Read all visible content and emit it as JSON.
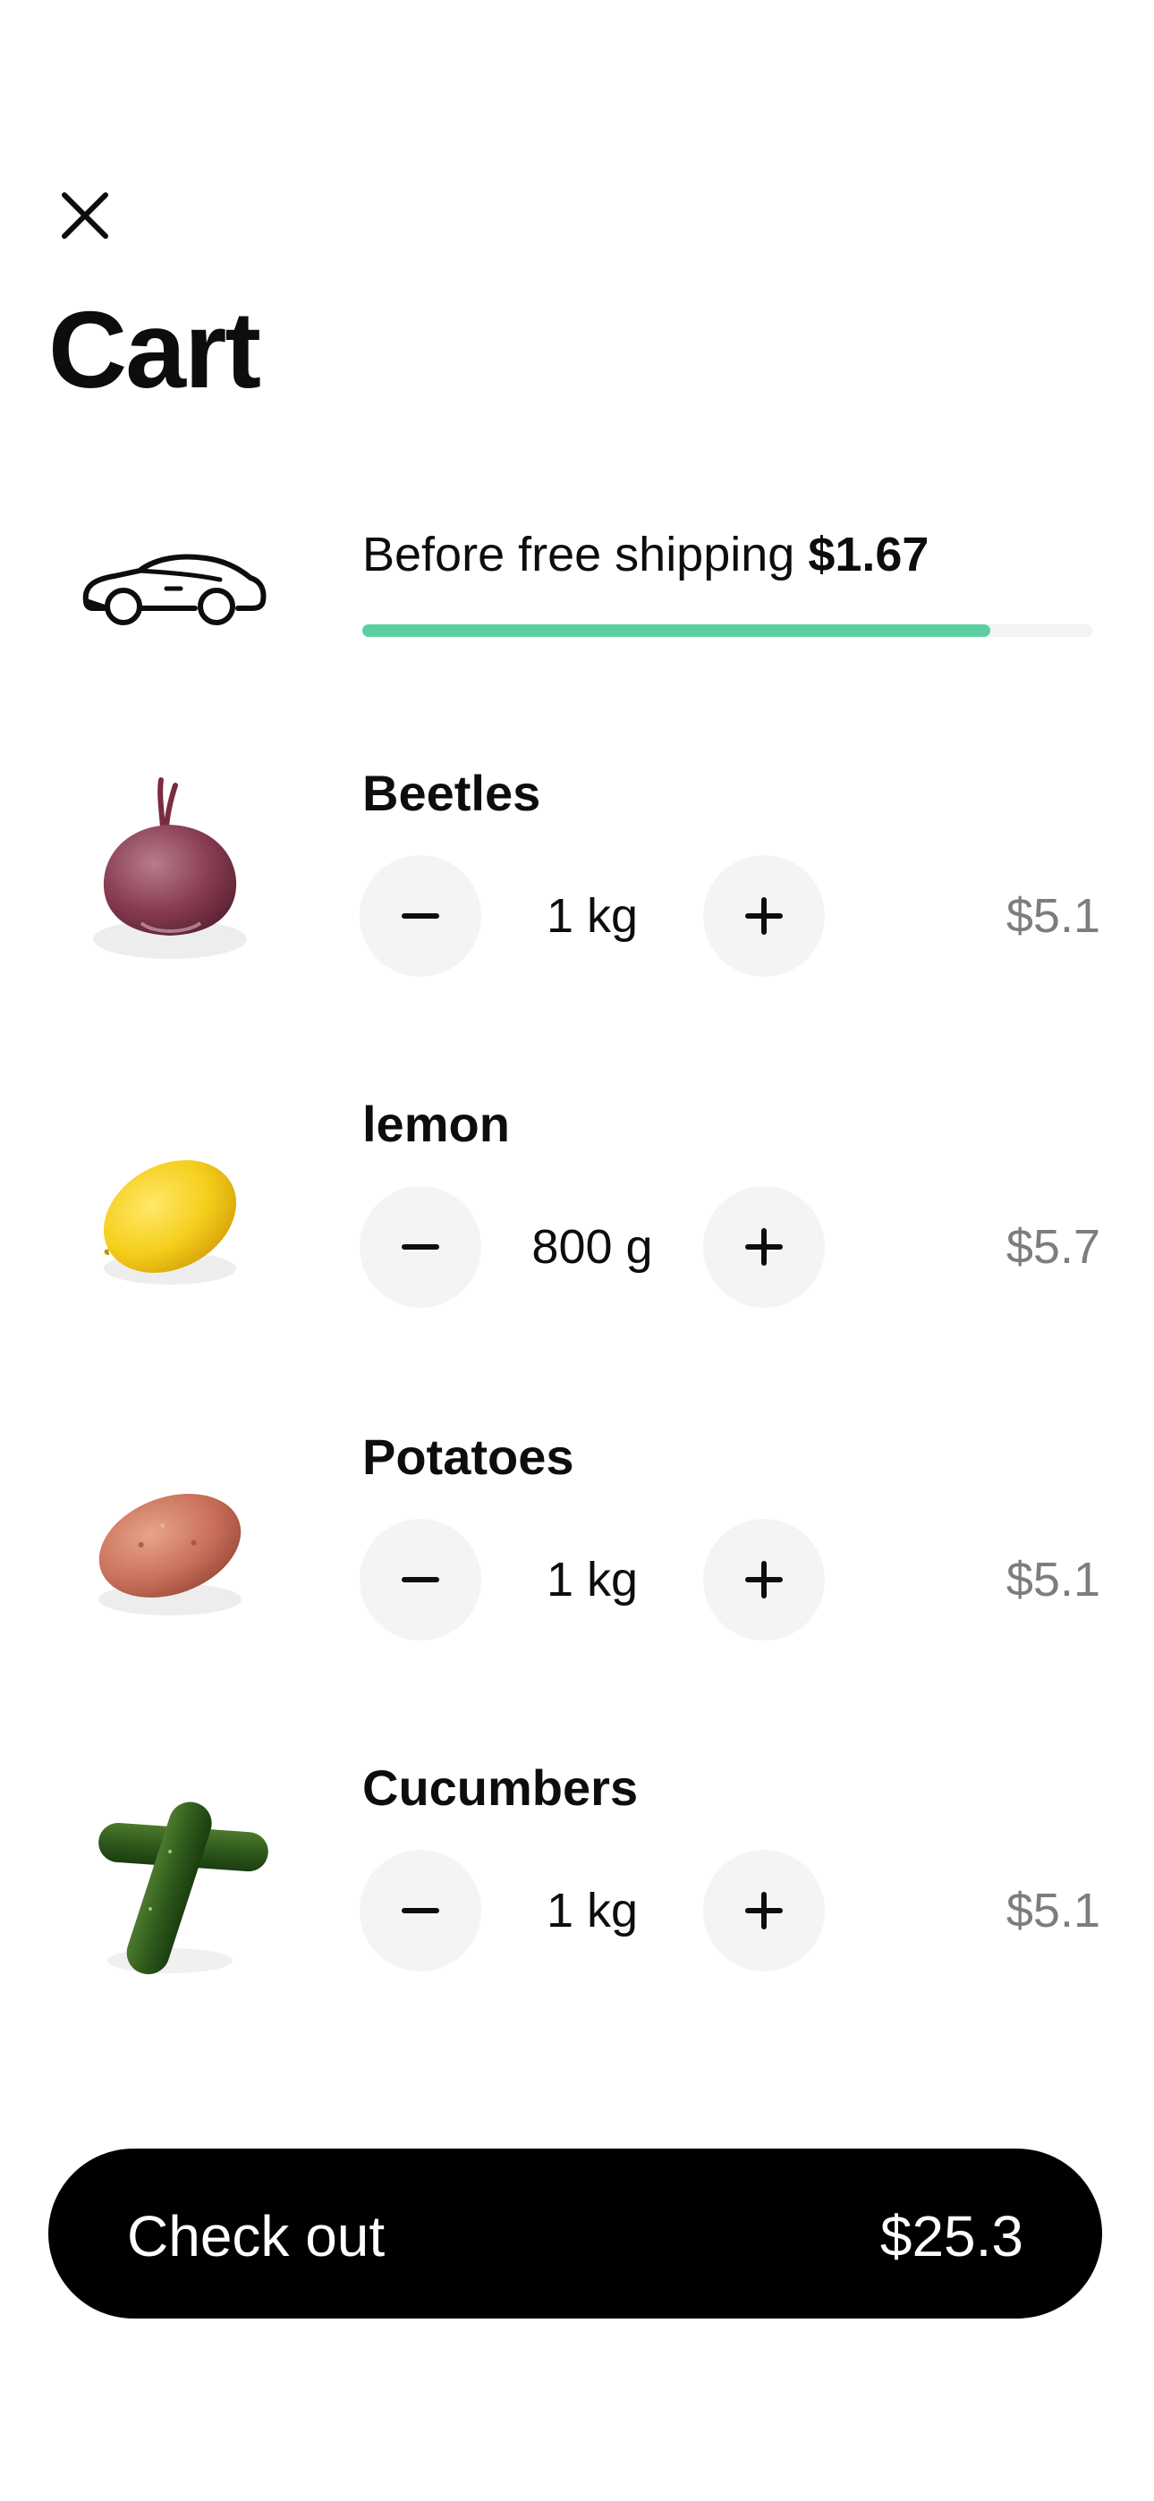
{
  "header": {
    "title": "Cart"
  },
  "shipping": {
    "text": "Before free shipping",
    "amount": "$1.67",
    "progress": 0.86
  },
  "items": [
    {
      "name": "Beetles",
      "quantity": "1 kg",
      "price": "$5.1",
      "image": "beet"
    },
    {
      "name": "lemon",
      "quantity": "800 g",
      "price": "$5.7",
      "image": "lemon"
    },
    {
      "name": "Potatoes",
      "quantity": "1 kg",
      "price": "$5.1",
      "image": "potato"
    },
    {
      "name": "Cucumbers",
      "quantity": "1 kg",
      "price": "$5.1",
      "image": "cucumber"
    }
  ],
  "checkout": {
    "label": "Check out",
    "total": "$25.3"
  },
  "colors": {
    "progress": "#5ccfa0",
    "button_bg": "#f5f4f2",
    "checkout_bg": "#000000",
    "price": "#7d7d7d"
  },
  "icons": {
    "close": "close-icon",
    "car": "car-icon",
    "minus": "minus-icon",
    "plus": "plus-icon"
  }
}
